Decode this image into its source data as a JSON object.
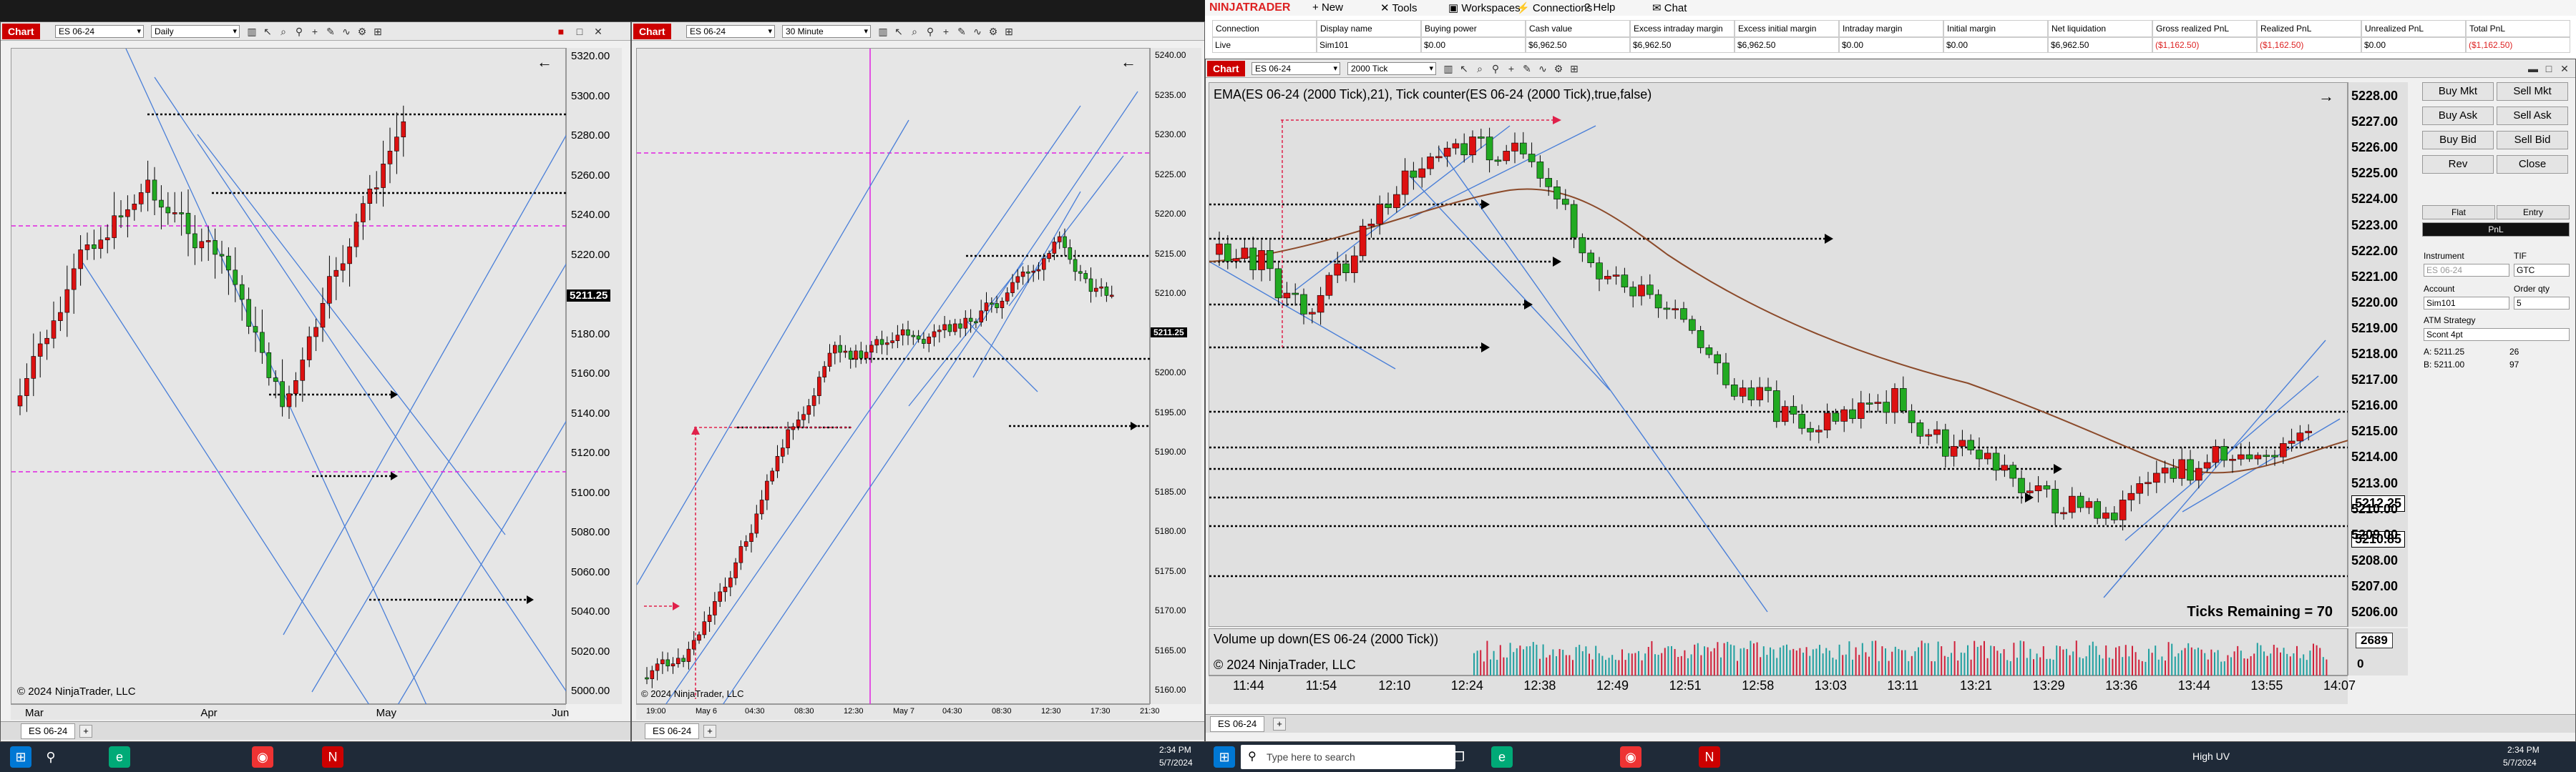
{
  "left_chart": {
    "tab_label": "Chart",
    "instrument": "ES 06-24",
    "interval": "Daily",
    "price_ticks": [
      "5320.00",
      "5300.00",
      "5280.00",
      "5260.00",
      "5240.00",
      "5220.00",
      "5200.00",
      "5180.00",
      "5160.00",
      "5140.00",
      "5120.00",
      "5100.00",
      "5080.00",
      "5060.00",
      "5040.00",
      "5020.00",
      "5000.00"
    ],
    "current_price": "5211.25",
    "time_ticks": [
      "Mar",
      "Apr",
      "May",
      "Jun"
    ],
    "copyright": "© 2024 NinjaTrader, LLC",
    "bottom_tab": "ES 06-24"
  },
  "mid_chart": {
    "tab_label": "Chart",
    "instrument": "ES 06-24",
    "interval": "30 Minute",
    "price_ticks": [
      "5240.00",
      "5235.00",
      "5230.00",
      "5225.00",
      "5220.00",
      "5215.00",
      "5210.00",
      "5205.00",
      "5200.00",
      "5195.00",
      "5190.00",
      "5185.00",
      "5180.00",
      "5175.00",
      "5170.00",
      "5165.00",
      "5160.00"
    ],
    "current_price": "5211.25",
    "time_ticks": [
      "19:00",
      "May 6",
      "04:30",
      "08:30",
      "12:30",
      "May 7",
      "04:30",
      "08:30",
      "12:30",
      "17:30",
      "21:30"
    ],
    "copyright": "© 2024 NinjaTrader, LLC",
    "bottom_tab": "ES 06-24"
  },
  "control_center": {
    "brand": "NINJATRADER",
    "menu": [
      "New",
      "Tools",
      "Workspaces",
      "Connections",
      "Help",
      "Chat"
    ],
    "columns": [
      "Connection",
      "Display name",
      "Buying power",
      "Cash value",
      "Excess intraday margin",
      "Excess initial margin",
      "Intraday margin",
      "Initial margin",
      "Net liquidation",
      "Gross realized PnL",
      "Realized PnL",
      "Unrealized PnL",
      "Total PnL"
    ],
    "row": [
      "Live",
      "Sim101",
      "$0.00",
      "$6,962.50",
      "$6,962.50",
      "$6,962.50",
      "$0.00",
      "$0.00",
      "$6,962.50",
      "($1,162.50)",
      "($1,162.50)",
      "$0.00",
      "($1,162.50)"
    ]
  },
  "main_chart": {
    "tab_label": "Chart",
    "instrument": "ES 06-24",
    "interval": "2000 Tick",
    "indicator_title": "EMA(ES 06-24 (2000 Tick),21), Tick counter(ES 06-24 (2000 Tick),true,false)",
    "price_ticks": [
      "5228.00",
      "5227.00",
      "5226.00",
      "5225.00",
      "5224.00",
      "5223.00",
      "5222.00",
      "5221.00",
      "5220.00",
      "5219.00",
      "5218.00",
      "5217.00",
      "5216.00",
      "5215.00",
      "5214.00",
      "5213.00",
      "5212.25",
      "5210.85",
      "5210.00",
      "5209.00",
      "5208.00",
      "5207.00",
      "5206.00"
    ],
    "ticks_remaining": "Ticks Remaining = 70",
    "volume_title": "Volume up down(ES 06-24 (2000 Tick))",
    "volume_value": "2689",
    "volume_zero": "0",
    "copyright": "© 2024 NinjaTrader, LLC",
    "time_ticks": [
      "11:44",
      "11:54",
      "12:10",
      "12:24",
      "12:38",
      "12:49",
      "12:51",
      "12:58",
      "13:03",
      "13:11",
      "13:21",
      "13:29",
      "13:36",
      "13:44",
      "13:55",
      "14:07"
    ],
    "bottom_tab": "ES 06-24"
  },
  "order_panel": {
    "buttons": [
      "Buy Mkt",
      "Sell Mkt",
      "Buy Ask",
      "Sell Ask",
      "Buy Bid",
      "Sell Bid",
      "Rev",
      "Close"
    ],
    "flat": "Flat",
    "entry": "Entry",
    "pnl": "PnL",
    "instrument_label": "Instrument",
    "instrument_value": "ES 06-24",
    "tif_label": "TIF",
    "tif_value": "GTC",
    "account_label": "Account",
    "account_value": "Sim101",
    "qty_label": "Order qty",
    "qty_value": "5",
    "atm_label": "ATM Strategy",
    "atm_value": "Scont 4pt",
    "ask_label": "A: 5211.25",
    "ask_size": "26",
    "bid_label": "B: 5211.00",
    "bid_size": "97"
  },
  "taskbar": {
    "search_placeholder": "Type here to search",
    "time": "2:34 PM",
    "date": "5/7/2024",
    "weather": "High UV",
    "left_time": "2:34 PM",
    "left_date": "5/7/2024"
  }
}
